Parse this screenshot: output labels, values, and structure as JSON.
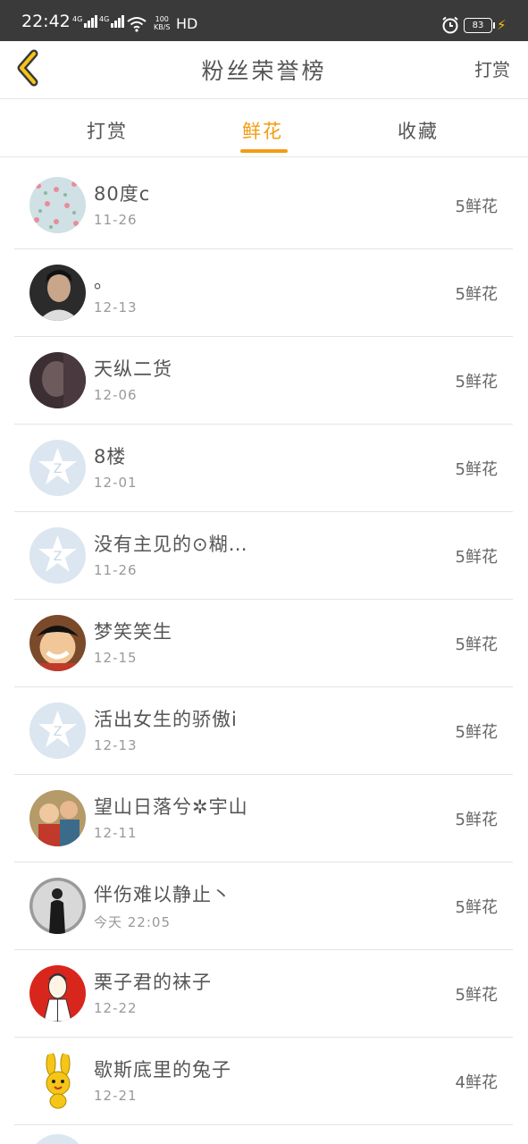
{
  "status_bar": {
    "time": "22:42",
    "network1": "4G",
    "network2": "4G",
    "speed_value": "100",
    "speed_unit": "KB/S",
    "hd": "HD",
    "battery": "83"
  },
  "header": {
    "title": "粉丝荣誉榜",
    "reward_link": "打赏"
  },
  "tabs": [
    {
      "label": "打赏",
      "active": false
    },
    {
      "label": "鲜花",
      "active": true
    },
    {
      "label": "收藏",
      "active": false
    }
  ],
  "fans": [
    {
      "name": "80度c",
      "date": "11-26",
      "amount": "5鲜花",
      "avatar": "avatar-floral-pattern"
    },
    {
      "name": "。",
      "date": "12-13",
      "amount": "5鲜花",
      "avatar": "avatar-man-photo"
    },
    {
      "name": "天纵二货",
      "date": "12-06",
      "amount": "5鲜花",
      "avatar": "avatar-dark-photo"
    },
    {
      "name": "8楼",
      "date": "12-01",
      "amount": "5鲜花",
      "avatar": "avatar-default-qzone"
    },
    {
      "name": "没有主见的⊙糊…",
      "date": "11-26",
      "amount": "5鲜花",
      "avatar": "avatar-default-qzone"
    },
    {
      "name": "梦笑笑生",
      "date": "12-15",
      "amount": "5鲜花",
      "avatar": "avatar-anime-luffy"
    },
    {
      "name": "活出女生的骄傲i",
      "date": "12-13",
      "amount": "5鲜花",
      "avatar": "avatar-default-qzone"
    },
    {
      "name": "望山日落兮✲宇山",
      "date": "12-11",
      "amount": "5鲜花",
      "avatar": "avatar-children-photo"
    },
    {
      "name": "伴伤难以静止丶",
      "date": "今天 22:05",
      "amount": "5鲜花",
      "avatar": "avatar-bw-figure"
    },
    {
      "name": "栗子君的袜子",
      "date": "12-22",
      "amount": "5鲜花",
      "avatar": "avatar-red-cartoon"
    },
    {
      "name": "歇斯底里的兔子",
      "date": "12-21",
      "amount": "4鲜花",
      "avatar": "avatar-yellow-rabbit"
    }
  ],
  "colors": {
    "accent": "#f39c12",
    "status_bar": "#3a3a3a",
    "back_arrow": "#f5c518"
  }
}
